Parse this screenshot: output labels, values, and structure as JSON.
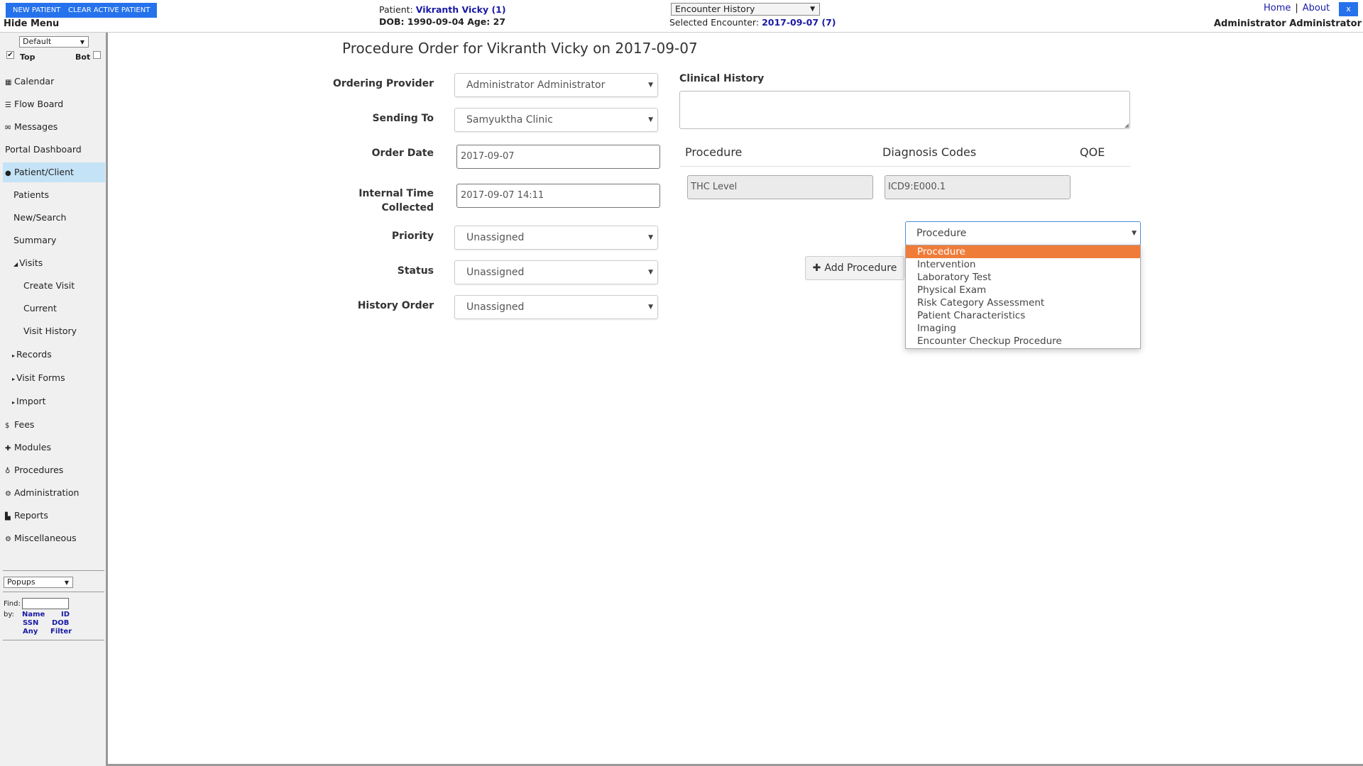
{
  "topbar": {
    "new_patient": "NEW PATIENT",
    "clear_patient": "CLEAR ACTIVE PATIENT",
    "hide_menu": "Hide Menu",
    "patient_label": "Patient:",
    "patient_name": "Vikranth Vicky (1)",
    "dob_line": "DOB: 1990-09-04 Age: 27",
    "encounter_select": "Encounter History",
    "selected_encounter_label": "Selected Encounter:",
    "selected_encounter_value": "2017-09-07 (7)",
    "home": "Home",
    "about": "About",
    "close": "x",
    "user": "Administrator Administrator"
  },
  "sidebar": {
    "view_select": "Default",
    "top_label": "Top",
    "bot_label": "Bot",
    "items": [
      {
        "label": "Calendar",
        "icon": "calendar-icon"
      },
      {
        "label": "Flow Board",
        "icon": "list-icon"
      },
      {
        "label": "Messages",
        "icon": "envelope-icon"
      },
      {
        "label": "Portal Dashboard"
      },
      {
        "label": "Patient/Client",
        "icon": "user-icon"
      },
      {
        "label": "Patients"
      },
      {
        "label": "New/Search"
      },
      {
        "label": "Summary"
      },
      {
        "label": "Visits"
      },
      {
        "label": "Create Visit"
      },
      {
        "label": "Current"
      },
      {
        "label": "Visit History"
      },
      {
        "label": "Records"
      },
      {
        "label": "Visit Forms"
      },
      {
        "label": "Import"
      },
      {
        "label": "Fees",
        "icon": "dollar-icon"
      },
      {
        "label": "Modules",
        "icon": "puzzle-icon"
      },
      {
        "label": "Procedures",
        "icon": "stethoscope-icon"
      },
      {
        "label": "Administration",
        "icon": "gears-icon"
      },
      {
        "label": "Reports",
        "icon": "chart-icon"
      },
      {
        "label": "Miscellaneous",
        "icon": "gear-icon"
      }
    ],
    "popups_select": "Popups",
    "find_label": "Find:",
    "by_label": "by:",
    "find_links": [
      "Name",
      "ID",
      "SSN",
      "DOB",
      "Any",
      "Filter"
    ]
  },
  "main": {
    "title": "Procedure Order for Vikranth Vicky on 2017-09-07",
    "ordering_provider_label": "Ordering Provider",
    "ordering_provider": "Administrator Administrator",
    "sending_to_label": "Sending To",
    "sending_to": "Samyuktha Clinic",
    "order_date_label": "Order Date",
    "order_date": "2017-09-07",
    "internal_time_label_1": "Internal Time",
    "internal_time_label_2": "Collected",
    "internal_time": "2017-09-07 14:11",
    "priority_label": "Priority",
    "priority": "Unassigned",
    "status_label": "Status",
    "status": "Unassigned",
    "history_order_label": "History Order",
    "history_order": "Unassigned",
    "clinical_history_label": "Clinical History",
    "col_procedure": "Procedure",
    "col_diagnosis": "Diagnosis Codes",
    "col_qoe": "QOE",
    "procedure_value": "THC Level",
    "diagnosis_value": "ICD9:E000.1",
    "type_select": "Procedure",
    "type_options": [
      "Procedure",
      "Intervention",
      "Laboratory Test",
      "Physical Exam",
      "Risk Category Assessment",
      "Patient Characteristics",
      "Imaging",
      "Encounter Checkup Procedure"
    ],
    "add_procedure": "Add Procedure"
  },
  "colors": {
    "accent_blue": "#2672ec",
    "link_blue": "#1a1aa6",
    "active_nav": "#c5e3f6",
    "dropdown_highlight": "#f07c3a"
  }
}
